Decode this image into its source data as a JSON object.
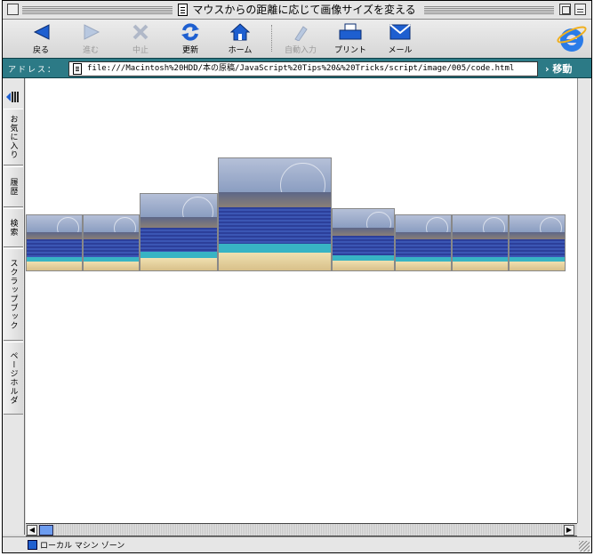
{
  "window": {
    "title": "マウスからの距離に応じて画像サイズを変える"
  },
  "toolbar": {
    "buttons": [
      {
        "label": "戻る",
        "icon": "back-arrow-icon"
      },
      {
        "label": "進む",
        "icon": "forward-arrow-icon",
        "disabled": true
      },
      {
        "label": "中止",
        "icon": "stop-icon",
        "disabled": true
      },
      {
        "label": "更新",
        "icon": "refresh-icon"
      },
      {
        "label": "ホーム",
        "icon": "home-icon"
      },
      {
        "label": "自動入力",
        "icon": "autofill-icon",
        "disabled": true
      },
      {
        "label": "プリント",
        "icon": "printer-icon"
      },
      {
        "label": "メール",
        "icon": "mail-icon"
      }
    ],
    "logo": "ie-logo-icon"
  },
  "address": {
    "label": "アドレス：",
    "url": "file:///Macintosh%20HDD/本の原稿/JavaScript%20Tips%20&%20Tricks/script/image/005/code.html",
    "go_label": "移動"
  },
  "sidebar": {
    "tabs": [
      "お気に入り",
      "履歴",
      "検索",
      "スクラップブック",
      "ページホルダ"
    ]
  },
  "status": {
    "text": "ローカル マシン ゾーン"
  },
  "colors": {
    "accent": "#2c7a86",
    "blue": "#1e5fd0"
  }
}
